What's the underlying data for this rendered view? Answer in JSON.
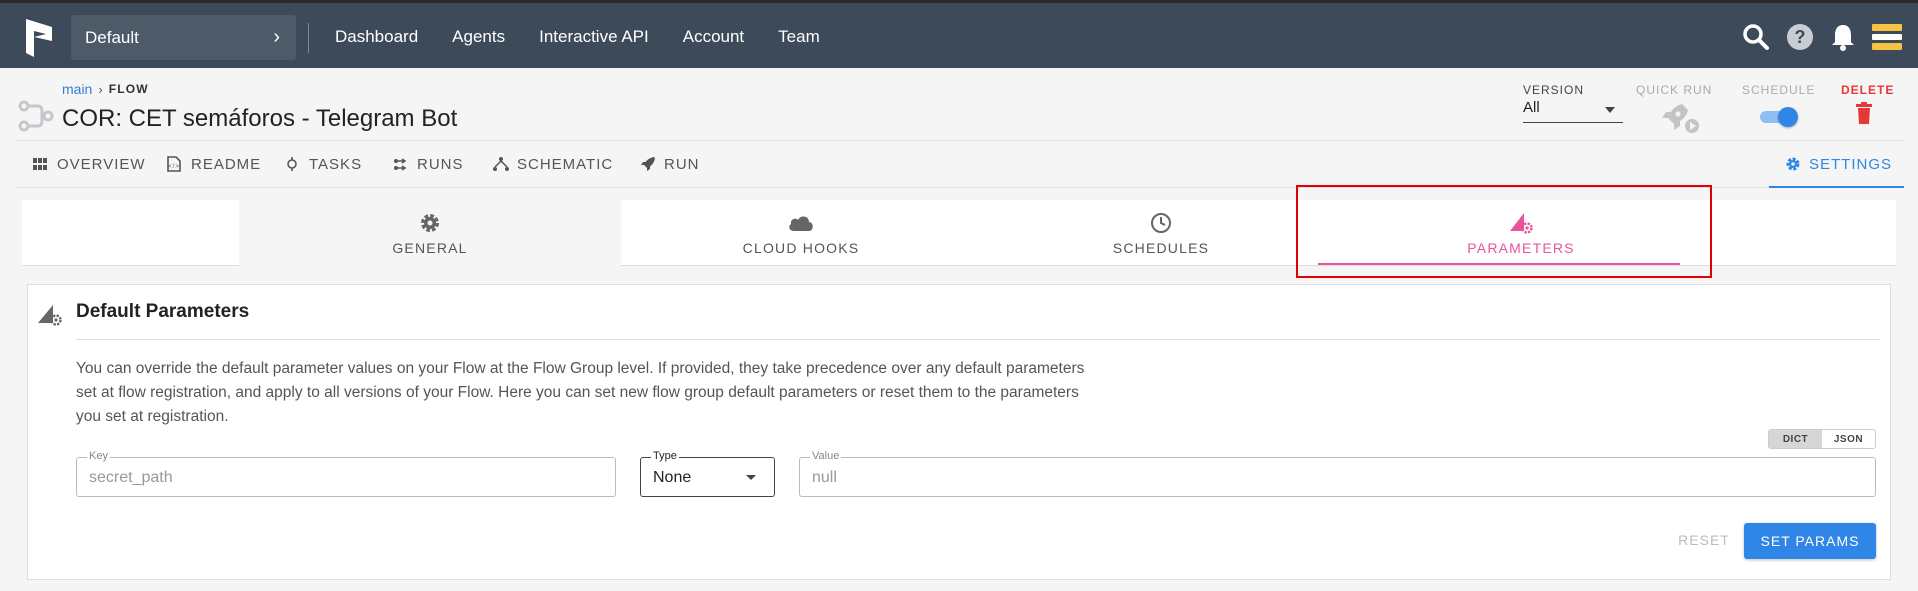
{
  "topbar": {
    "team": "Default",
    "nav": [
      "Dashboard",
      "Agents",
      "Interactive API",
      "Account",
      "Team"
    ]
  },
  "flow": {
    "breadcrumb_project": "main",
    "breadcrumb_type": "FLOW",
    "title": "COR: CET semáforos - Telegram Bot",
    "version_label": "VERSION",
    "version_value": "All",
    "quick_run_label": "QUICK RUN",
    "schedule_label": "SCHEDULE",
    "schedule_on": true,
    "delete_label": "DELETE"
  },
  "tabs": [
    {
      "label": "OVERVIEW",
      "icon": "grid-icon"
    },
    {
      "label": "README",
      "icon": "document-icon"
    },
    {
      "label": "TASKS",
      "icon": "task-icon"
    },
    {
      "label": "RUNS",
      "icon": "runs-icon"
    },
    {
      "label": "SCHEMATIC",
      "icon": "schematic-icon"
    },
    {
      "label": "RUN",
      "icon": "rocket-icon"
    },
    {
      "label": "SETTINGS",
      "icon": "gear-icon",
      "active": true
    }
  ],
  "settings_tabs": [
    {
      "label": "GENERAL",
      "icon": "gear-icon"
    },
    {
      "label": "CLOUD HOOKS",
      "icon": "cloud-icon"
    },
    {
      "label": "SCHEDULES",
      "icon": "clock-icon"
    },
    {
      "label": "PARAMETERS",
      "icon": "parameters-icon",
      "active": true
    }
  ],
  "card": {
    "title": "Default Parameters",
    "description": "You can override the default parameter values on your Flow at the Flow Group level. If provided, they take precedence over any default parameters set at flow registration, and apply to all versions of your Flow. Here you can set new flow group default parameters or reset them to the parameters you set at registration.",
    "mode_dict": "DICT",
    "mode_json": "JSON",
    "key_label": "Key",
    "key_placeholder": "secret_path",
    "type_label": "Type",
    "type_value": "None",
    "value_label": "Value",
    "value_placeholder": "null",
    "reset_label": "RESET",
    "set_label": "SET PARAMS"
  },
  "colors": {
    "topbar": "#3c4a59",
    "accent": "#2f86e6",
    "parameters_accent": "#e8559b",
    "delete": "#e53935",
    "highlight": "#e00000"
  }
}
